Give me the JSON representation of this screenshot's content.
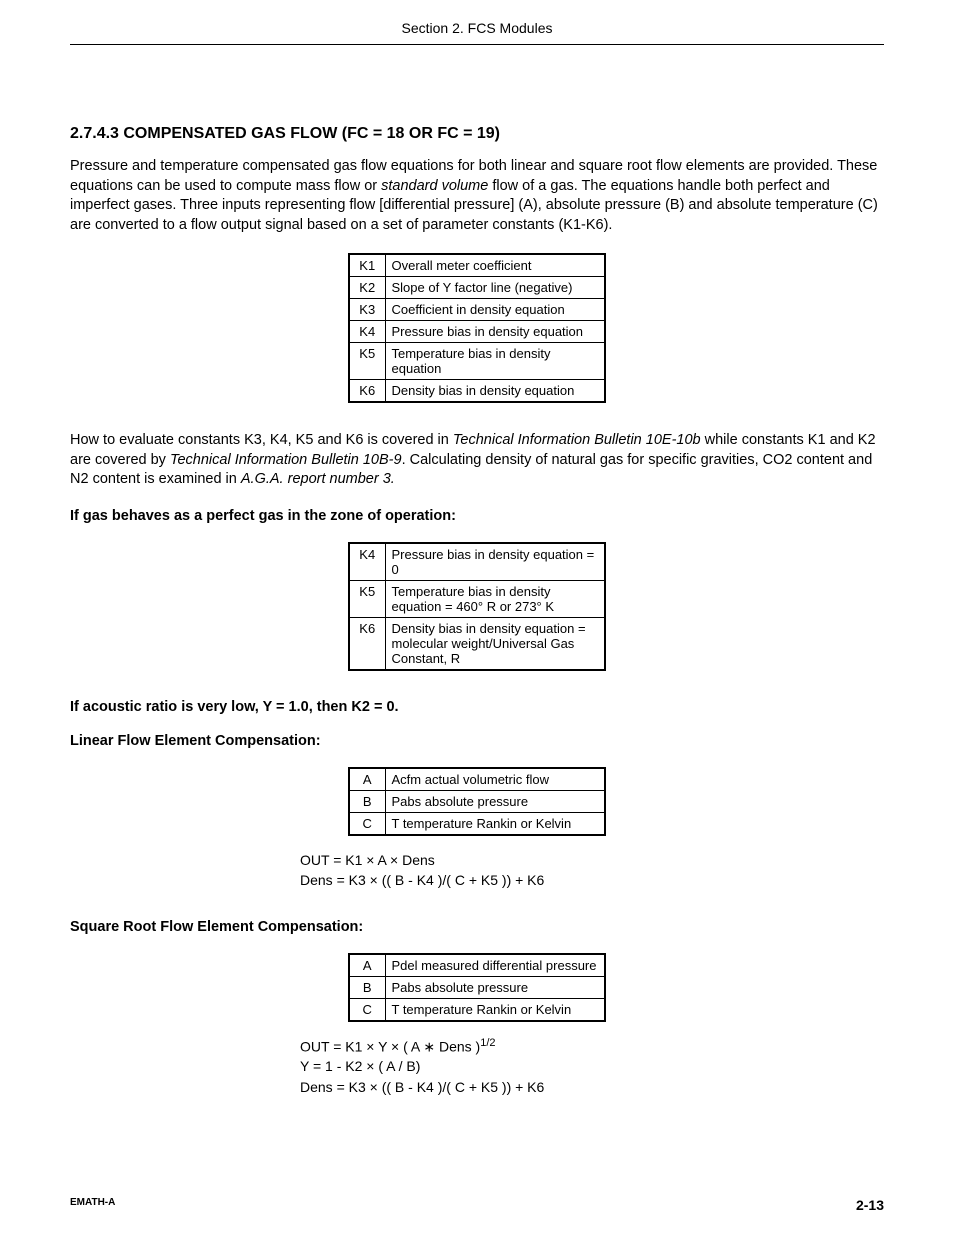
{
  "header": {
    "section_title": "Section 2. FCS Modules"
  },
  "main": {
    "heading": "2.7.4.3  COMPENSATED GAS FLOW (FC = 18 OR FC = 19)",
    "intro_before_italic": "Pressure and temperature compensated gas flow equations for both linear and square root flow elements are provided. These equations can be used to compute mass flow or ",
    "intro_italic": "standard volume",
    "intro_after_italic": " flow of a gas.  The equations handle both perfect and imperfect gases.  Three inputs representing flow [differential pressure] (A), absolute pressure (B) and absolute temperature (C) are converted to a flow output signal based on a set of parameter constants (K1-K6).",
    "table1": [
      {
        "k": "K1",
        "desc": "Overall meter coefficient"
      },
      {
        "k": "K2",
        "desc": "Slope of Y factor line (negative)"
      },
      {
        "k": "K3",
        "desc": "Coefficient in density equation"
      },
      {
        "k": "K4",
        "desc": "Pressure bias in density equation"
      },
      {
        "k": "K5",
        "desc": "Temperature bias in density equation"
      },
      {
        "k": "K6",
        "desc": "Density bias in density equation"
      }
    ],
    "howto_before_i1": "How to evaluate constants K3, K4, K5 and K6 is covered in ",
    "howto_i1": "Technical Information Bulletin 10E-10b",
    "howto_mid1": " while constants K1 and K2 are covered by ",
    "howto_i2": "Technical Information Bulletin 10B-9",
    "howto_mid2": ".  Calculating density of natural gas for specific gravities, CO2 content and N2 content is examined in ",
    "howto_i3": "A.G.A. report number 3.",
    "perfect_gas_heading": "If gas behaves as a perfect gas in the zone of operation:",
    "table2": [
      {
        "k": "K4",
        "desc": "Pressure bias in density equation = 0"
      },
      {
        "k": "K5",
        "desc": "Temperature bias in density equation = 460° R or 273° K"
      },
      {
        "k": "K6",
        "desc": "Density bias in density equation = molecular weight/Universal Gas Constant, R"
      }
    ],
    "acoustic_heading": "If acoustic ratio is very low, Y = 1.0, then K2 = 0.",
    "linear_heading": "Linear Flow Element Compensation:",
    "table3": [
      {
        "k": "A",
        "desc": "Acfm actual volumetric flow"
      },
      {
        "k": "B",
        "desc": "Pabs absolute pressure"
      },
      {
        "k": "C",
        "desc": "T temperature Rankin or Kelvin"
      }
    ],
    "linear_eq1": "OUT = K1 × A × Dens",
    "linear_eq2": "Dens = K3 × (( B - K4 )/( C + K5 )) + K6",
    "sqroot_heading": "Square Root Flow Element Compensation:",
    "table4": [
      {
        "k": "A",
        "desc": "Pdel measured differential pressure"
      },
      {
        "k": "B",
        "desc": "Pabs absolute pressure"
      },
      {
        "k": "C",
        "desc": "T temperature Rankin or Kelvin"
      }
    ],
    "sq_eq1_before": "OUT = K1 × Y × ( A ∗ Dens )",
    "sq_eq1_sup": "1/2",
    "sq_eq2": "Y = 1 - K2 × ( A / B)",
    "sq_eq3": "Dens = K3 × (( B - K4 )/( C + K5 )) + K6"
  },
  "footer": {
    "left": "EMATH-A",
    "right": "2-13"
  }
}
